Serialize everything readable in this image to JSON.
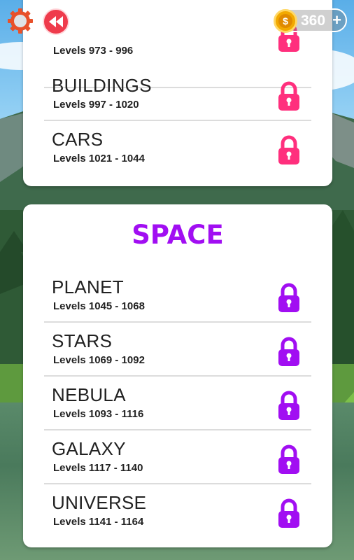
{
  "header": {
    "coin_count": "360",
    "gear_icon": "gear-icon",
    "back_icon": "rewind-icon",
    "coin_icon": "dollar-coin-icon",
    "coin_symbol": "$",
    "plus_icon": "plus-icon"
  },
  "colors": {
    "category_lock": "#ff2f7d",
    "space_lock": "#a10ef2",
    "space_title": "#a10ef2",
    "back_button": "#ef3b4c"
  },
  "top_card": {
    "rows": [
      {
        "name": "",
        "range": "Levels 973 - 996",
        "locked": true
      },
      {
        "name": "BUILDINGS",
        "range": "Levels 997 - 1020",
        "locked": true
      },
      {
        "name": "CARS",
        "range": "Levels 1021 - 1044",
        "locked": true
      }
    ]
  },
  "space_card": {
    "title": "SPACE",
    "rows": [
      {
        "name": "PLANET",
        "range": "Levels 1045 - 1068",
        "locked": true
      },
      {
        "name": "STARS",
        "range": "Levels 1069 - 1092",
        "locked": true
      },
      {
        "name": "NEBULA",
        "range": "Levels 1093 - 1116",
        "locked": true
      },
      {
        "name": "GALAXY",
        "range": "Levels 1117 - 1140",
        "locked": true
      },
      {
        "name": "UNIVERSE",
        "range": "Levels 1141 - 1164",
        "locked": true
      }
    ]
  }
}
